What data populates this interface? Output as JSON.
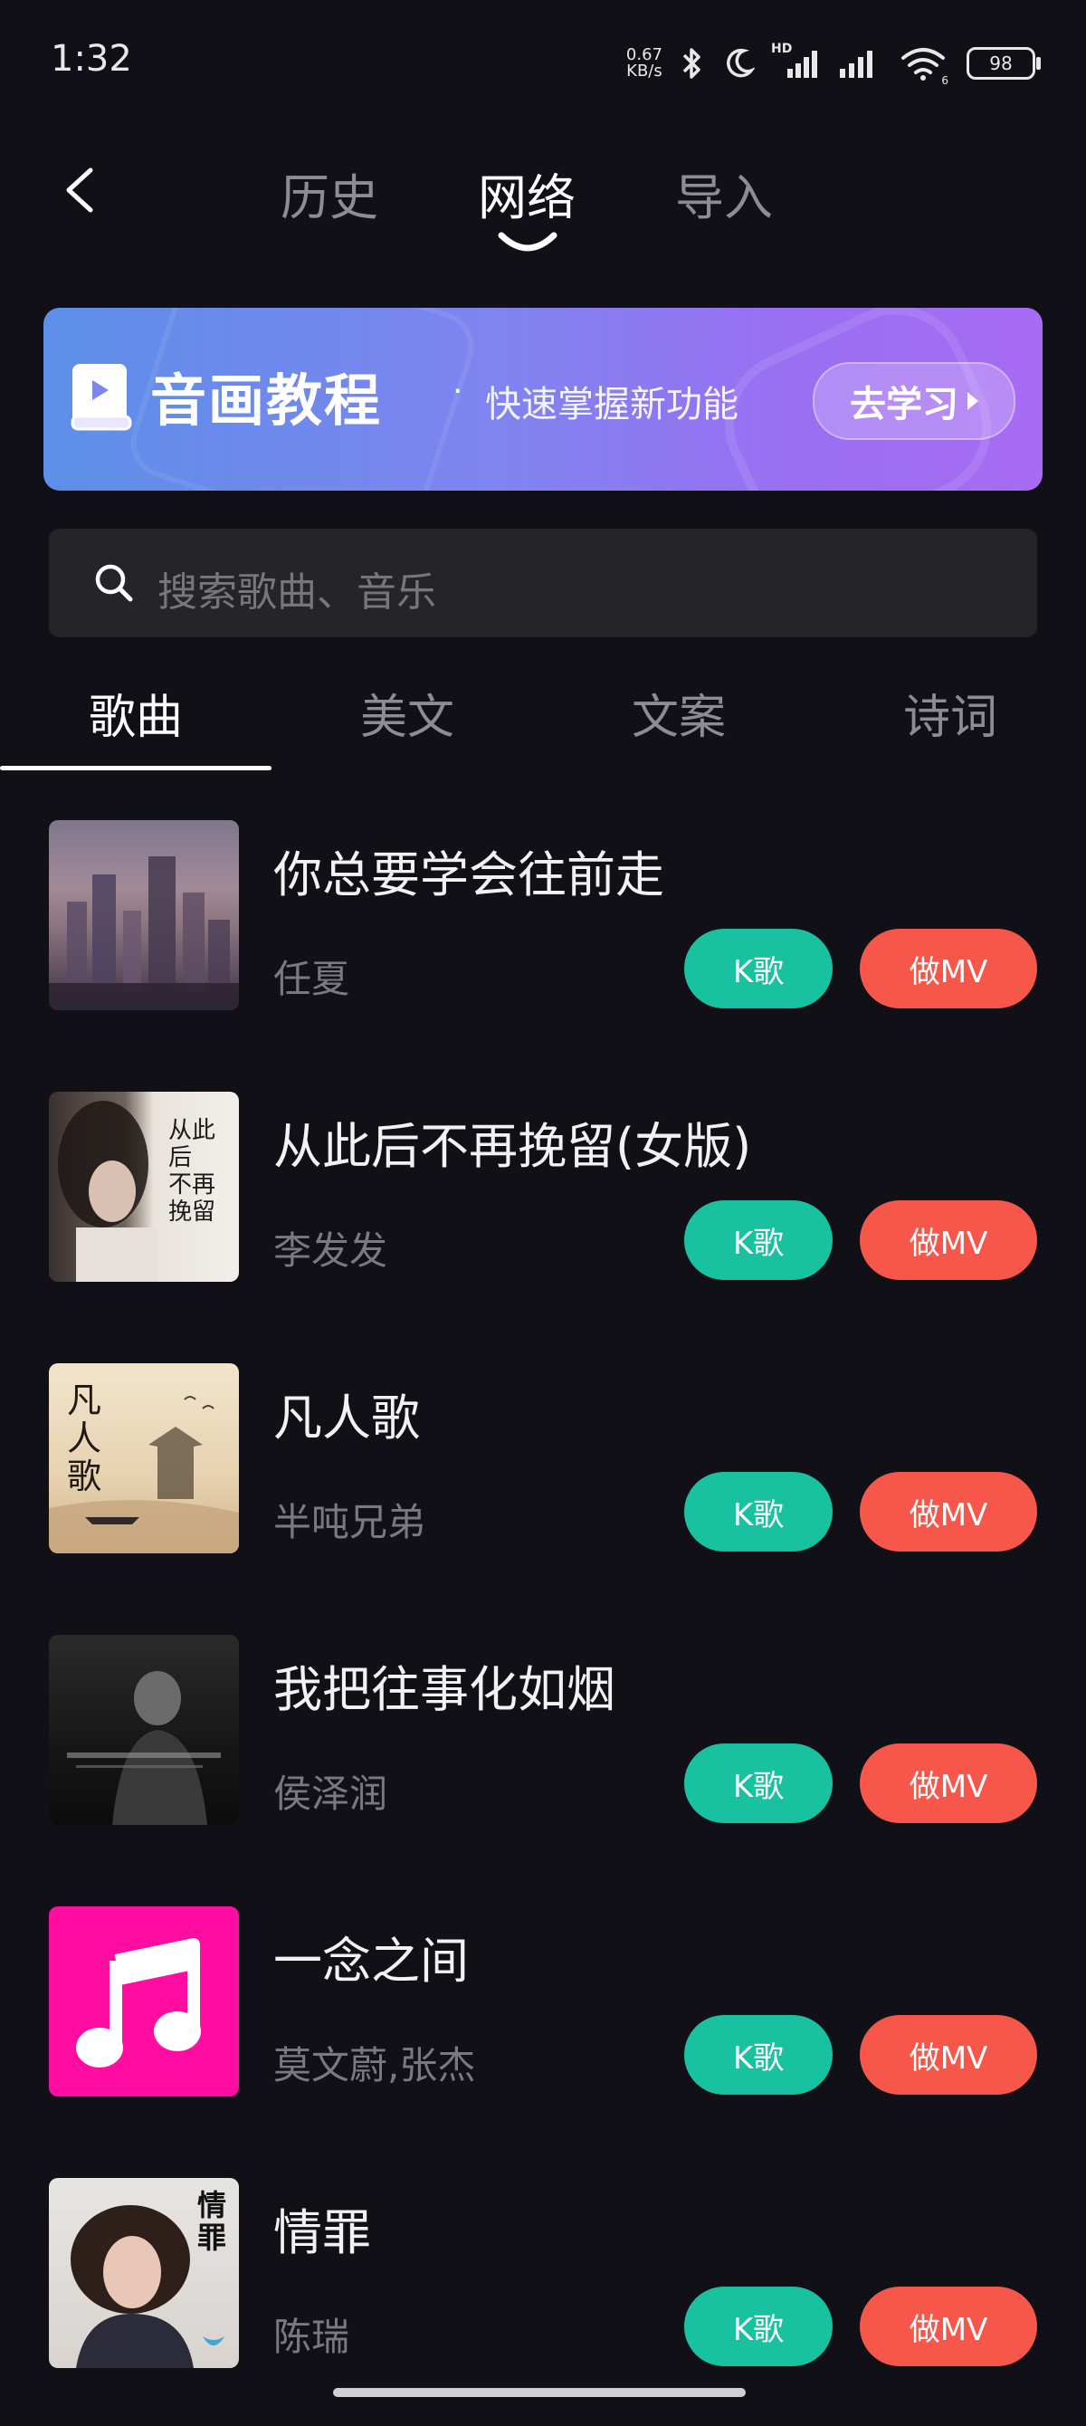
{
  "status_bar": {
    "time": "1:32",
    "net_speed_value": "0.67",
    "net_speed_unit": "KB/s",
    "signal_badge": "HD",
    "wifi_badge": "6",
    "battery": "98"
  },
  "header": {
    "tabs": [
      {
        "label": "历史",
        "active": false
      },
      {
        "label": "网络",
        "active": true
      },
      {
        "label": "导入",
        "active": false
      }
    ]
  },
  "banner": {
    "title": "音画教程",
    "dot": "·",
    "subtitle": "快速掌握新功能",
    "button": "去学习"
  },
  "search": {
    "placeholder": "搜索歌曲、音乐"
  },
  "category_tabs": [
    {
      "label": "歌曲",
      "active": true
    },
    {
      "label": "美文",
      "active": false
    },
    {
      "label": "文案",
      "active": false
    },
    {
      "label": "诗词",
      "active": false
    }
  ],
  "songs": [
    {
      "title": "你总要学会往前走",
      "artist": "任夏",
      "k_label": "K歌",
      "mv_label": "做MV"
    },
    {
      "title": "从此后不再挽留(女版)",
      "artist": "李发发",
      "k_label": "K歌",
      "mv_label": "做MV",
      "cover_text": "从此后 不再挽留"
    },
    {
      "title": "凡人歌",
      "artist": "半吨兄弟",
      "k_label": "K歌",
      "mv_label": "做MV",
      "cover_text": "凡人歌"
    },
    {
      "title": "我把往事化如烟",
      "artist": "侯泽润",
      "k_label": "K歌",
      "mv_label": "做MV"
    },
    {
      "title": "一念之间",
      "artist": "莫文蔚,张杰",
      "k_label": "K歌",
      "mv_label": "做MV"
    },
    {
      "title": "情罪",
      "artist": "陈瑞",
      "k_label": "K歌",
      "mv_label": "做MV",
      "cover_text": "情罪"
    }
  ],
  "colors": {
    "background": "#111016",
    "k_button": "#18c2a0",
    "mv_button": "#f6574a",
    "banner_start": "#5c8fe8",
    "banner_end": "#a76cf3",
    "tab_inactive": "#8d8c94"
  },
  "icons": [
    "back-icon",
    "search-icon",
    "book-icon",
    "music-note-icon",
    "bluetooth-icon",
    "moon-icon",
    "signal-icon",
    "wifi-icon",
    "battery-icon"
  ]
}
